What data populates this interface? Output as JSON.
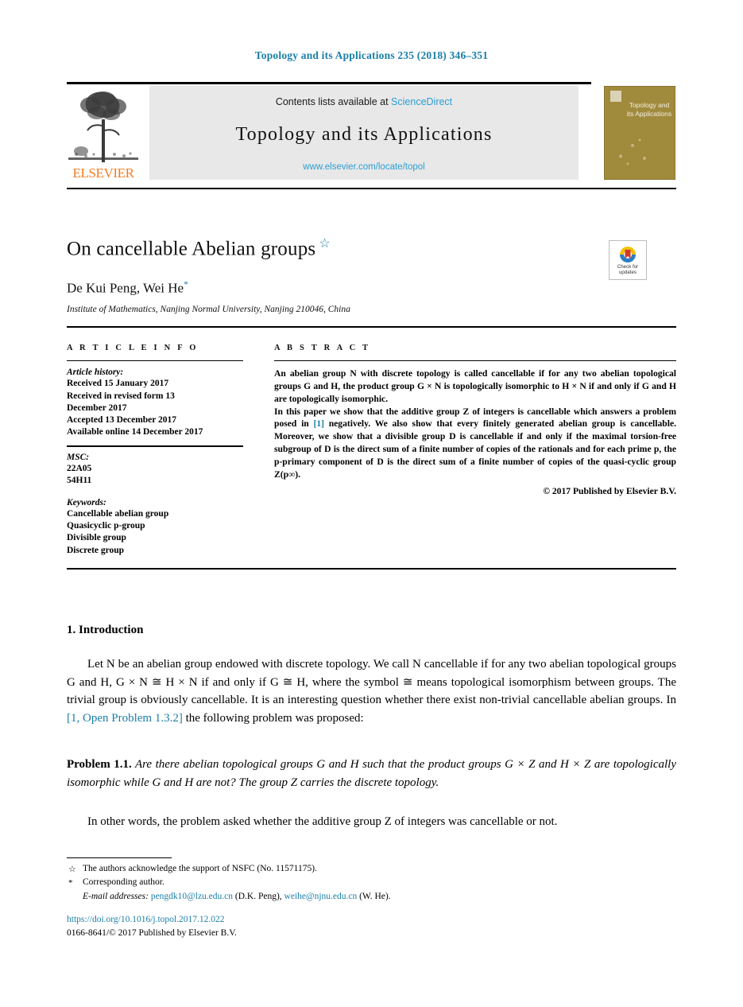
{
  "running_head": "Topology and its Applications 235 (2018) 346–351",
  "masthead": {
    "publisher_wordmark": "ELSEVIER",
    "contents_prefix": "Contents lists available at",
    "contents_link": "ScienceDirect",
    "journal_title": "Topology and its Applications",
    "journal_url": "www.elsevier.com/locate/topol",
    "cover_title": "Topology and its Applications"
  },
  "article": {
    "title": "On cancellable Abelian groups",
    "title_footnote_marker": "☆",
    "authors": "De Kui Peng, Wei He",
    "author_footnote_marker": "*",
    "affiliation": "Institute of Mathematics, Nanjing Normal University, Nanjing 210046, China"
  },
  "crossmark": {
    "line1": "Check for",
    "line2": "updates",
    "colors": {
      "red": "#d9362b",
      "yellow": "#f2c200",
      "blue": "#2b7fc4"
    }
  },
  "info": {
    "heading": "A R T I C L E   I N F O",
    "history_label": "Article history:",
    "history": [
      "Received 15 January 2017",
      "Received in revised form 13",
      "December 2017",
      "Accepted 13 December 2017",
      "Available online 14 December 2017"
    ],
    "msc_label": "MSC:",
    "msc": [
      "22A05",
      "54H11"
    ],
    "keywords_label": "Keywords:",
    "keywords": [
      "Cancellable abelian group",
      "Quasicyclic p-group",
      "Divisible group",
      "Discrete group"
    ]
  },
  "abstract": {
    "heading": "A B S T R A C T",
    "para1_a": "An abelian group ",
    "para1_italic": "cancellable",
    "para1_full": "An abelian group N with discrete topology is called cancellable if for any two abelian topological groups G and H, the product group G × N is topologically isomorphic to H × N if and only if G and H are topologically isomorphic.",
    "para2_pre": "In this paper we show that the additive group Z of integers is cancellable which answers a problem posed in ",
    "para2_cite": "[1]",
    "para2_post": " negatively. We also show that every finitely generated abelian group is cancellable. Moreover, we show that a divisible group D is cancellable if and only if the maximal torsion-free subgroup of D is the direct sum of a finite number of copies of the rationals and for each prime p, the p-primary component of D is the direct sum of a finite number of copies of the quasi-cyclic group Z(p∞).",
    "copyright": "© 2017 Published by Elsevier B.V."
  },
  "body": {
    "section_title": "1.  Introduction",
    "intro_pre": "Let N be an abelian group endowed with discrete topology. We call N cancellable if for any two abelian topological groups G and H, G × N ≅ H × N if and only if G ≅ H, where the symbol ≅ means topological isomorphism between groups. The trivial group is obviously cancellable. It is an interesting question whether there exist non-trivial cancellable abelian groups. In ",
    "intro_cite": "[1, Open Problem 1.3.2]",
    "intro_post": " the following problem was proposed:",
    "problem_label": "Problem 1.1.",
    "problem_text": " Are there abelian topological groups G and H such that the product groups G × Z and H × Z are topologically isomorphic while G and H are not? The group Z carries the discrete topology.",
    "closing": "In other words, the problem asked whether the additive group Z of integers was cancellable or not."
  },
  "footnotes": {
    "star_mark": "☆",
    "star_text": "The authors acknowledge the support of NSFC (No. 11571175).",
    "corr_mark": "*",
    "corr_text": "Corresponding author.",
    "email_label": "E-mail addresses:",
    "email1": "pengdk10@lzu.edu.cn",
    "email1_owner": " (D.K. Peng), ",
    "email2": "weihe@njnu.edu.cn",
    "email2_owner": " (W. He)."
  },
  "footer": {
    "doi": "https://doi.org/10.1016/j.topol.2017.12.022",
    "issn_line": "0166-8641/© 2017 Published by Elsevier B.V."
  }
}
